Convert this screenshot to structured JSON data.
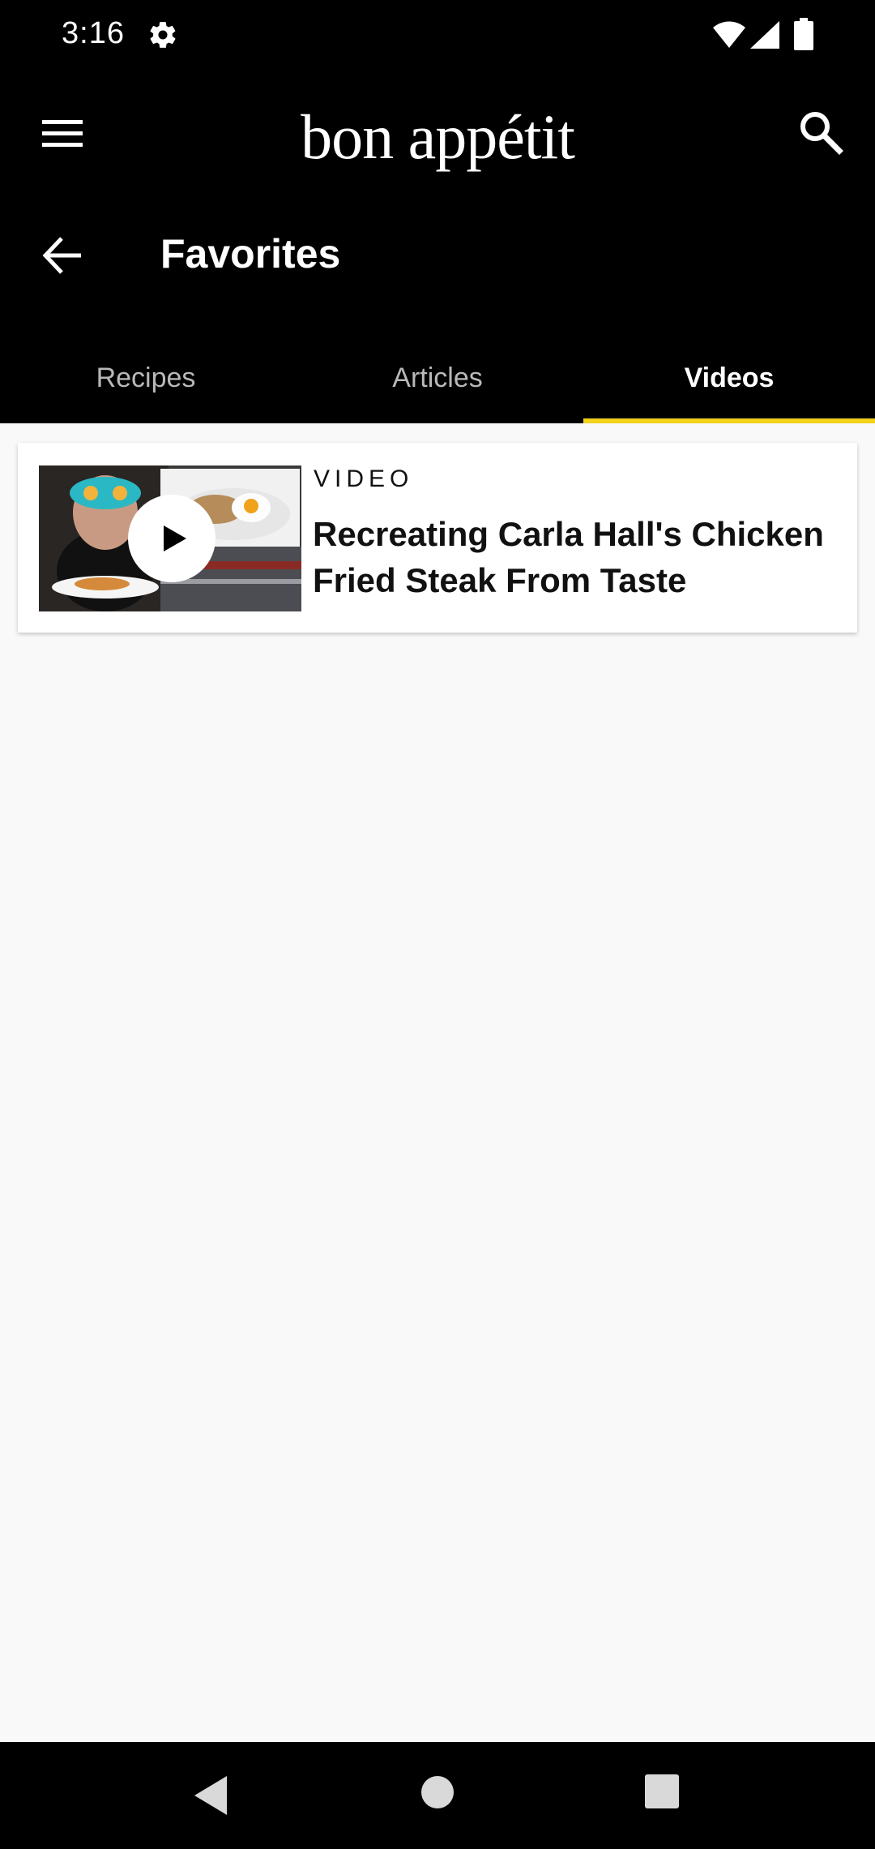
{
  "status_bar": {
    "time": "3:16",
    "icons": [
      "gear-icon",
      "wifi-icon",
      "cell-signal-icon",
      "battery-icon"
    ]
  },
  "app_bar": {
    "brand": "bon appétit",
    "title": "Favorites",
    "icons": [
      "menu-icon",
      "search-icon",
      "back-arrow-icon"
    ]
  },
  "tabs": [
    {
      "label": "Recipes",
      "active": false
    },
    {
      "label": "Articles",
      "active": false
    },
    {
      "label": "Videos",
      "active": true
    }
  ],
  "colors": {
    "app_bar_bg": "#000000",
    "tab_indicator": "#f2d21a",
    "content_bg": "#f9f9f9"
  },
  "favorites": [
    {
      "kicker": "VIDEO",
      "title": "Recreating Carla Hall's Chicken Fried Steak From Taste",
      "thumbnail": "video-thumbnail-with-play-icon"
    }
  ],
  "nav_bar": {
    "icons": [
      "nav-back-icon",
      "nav-home-icon",
      "nav-recents-icon"
    ]
  }
}
